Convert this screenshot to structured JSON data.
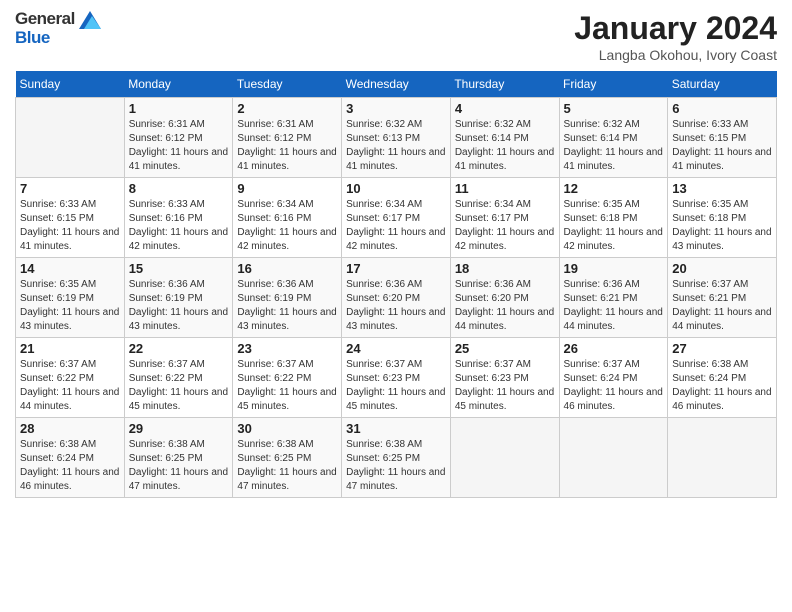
{
  "logo": {
    "general": "General",
    "blue": "Blue"
  },
  "title": "January 2024",
  "subtitle": "Langba Okohou, Ivory Coast",
  "days_header": [
    "Sunday",
    "Monday",
    "Tuesday",
    "Wednesday",
    "Thursday",
    "Friday",
    "Saturday"
  ],
  "weeks": [
    [
      {
        "num": "",
        "sunrise": "",
        "sunset": "",
        "daylight": ""
      },
      {
        "num": "1",
        "sunrise": "Sunrise: 6:31 AM",
        "sunset": "Sunset: 6:12 PM",
        "daylight": "Daylight: 11 hours and 41 minutes."
      },
      {
        "num": "2",
        "sunrise": "Sunrise: 6:31 AM",
        "sunset": "Sunset: 6:12 PM",
        "daylight": "Daylight: 11 hours and 41 minutes."
      },
      {
        "num": "3",
        "sunrise": "Sunrise: 6:32 AM",
        "sunset": "Sunset: 6:13 PM",
        "daylight": "Daylight: 11 hours and 41 minutes."
      },
      {
        "num": "4",
        "sunrise": "Sunrise: 6:32 AM",
        "sunset": "Sunset: 6:14 PM",
        "daylight": "Daylight: 11 hours and 41 minutes."
      },
      {
        "num": "5",
        "sunrise": "Sunrise: 6:32 AM",
        "sunset": "Sunset: 6:14 PM",
        "daylight": "Daylight: 11 hours and 41 minutes."
      },
      {
        "num": "6",
        "sunrise": "Sunrise: 6:33 AM",
        "sunset": "Sunset: 6:15 PM",
        "daylight": "Daylight: 11 hours and 41 minutes."
      }
    ],
    [
      {
        "num": "7",
        "sunrise": "Sunrise: 6:33 AM",
        "sunset": "Sunset: 6:15 PM",
        "daylight": "Daylight: 11 hours and 41 minutes."
      },
      {
        "num": "8",
        "sunrise": "Sunrise: 6:33 AM",
        "sunset": "Sunset: 6:16 PM",
        "daylight": "Daylight: 11 hours and 42 minutes."
      },
      {
        "num": "9",
        "sunrise": "Sunrise: 6:34 AM",
        "sunset": "Sunset: 6:16 PM",
        "daylight": "Daylight: 11 hours and 42 minutes."
      },
      {
        "num": "10",
        "sunrise": "Sunrise: 6:34 AM",
        "sunset": "Sunset: 6:17 PM",
        "daylight": "Daylight: 11 hours and 42 minutes."
      },
      {
        "num": "11",
        "sunrise": "Sunrise: 6:34 AM",
        "sunset": "Sunset: 6:17 PM",
        "daylight": "Daylight: 11 hours and 42 minutes."
      },
      {
        "num": "12",
        "sunrise": "Sunrise: 6:35 AM",
        "sunset": "Sunset: 6:18 PM",
        "daylight": "Daylight: 11 hours and 42 minutes."
      },
      {
        "num": "13",
        "sunrise": "Sunrise: 6:35 AM",
        "sunset": "Sunset: 6:18 PM",
        "daylight": "Daylight: 11 hours and 43 minutes."
      }
    ],
    [
      {
        "num": "14",
        "sunrise": "Sunrise: 6:35 AM",
        "sunset": "Sunset: 6:19 PM",
        "daylight": "Daylight: 11 hours and 43 minutes."
      },
      {
        "num": "15",
        "sunrise": "Sunrise: 6:36 AM",
        "sunset": "Sunset: 6:19 PM",
        "daylight": "Daylight: 11 hours and 43 minutes."
      },
      {
        "num": "16",
        "sunrise": "Sunrise: 6:36 AM",
        "sunset": "Sunset: 6:19 PM",
        "daylight": "Daylight: 11 hours and 43 minutes."
      },
      {
        "num": "17",
        "sunrise": "Sunrise: 6:36 AM",
        "sunset": "Sunset: 6:20 PM",
        "daylight": "Daylight: 11 hours and 43 minutes."
      },
      {
        "num": "18",
        "sunrise": "Sunrise: 6:36 AM",
        "sunset": "Sunset: 6:20 PM",
        "daylight": "Daylight: 11 hours and 44 minutes."
      },
      {
        "num": "19",
        "sunrise": "Sunrise: 6:36 AM",
        "sunset": "Sunset: 6:21 PM",
        "daylight": "Daylight: 11 hours and 44 minutes."
      },
      {
        "num": "20",
        "sunrise": "Sunrise: 6:37 AM",
        "sunset": "Sunset: 6:21 PM",
        "daylight": "Daylight: 11 hours and 44 minutes."
      }
    ],
    [
      {
        "num": "21",
        "sunrise": "Sunrise: 6:37 AM",
        "sunset": "Sunset: 6:22 PM",
        "daylight": "Daylight: 11 hours and 44 minutes."
      },
      {
        "num": "22",
        "sunrise": "Sunrise: 6:37 AM",
        "sunset": "Sunset: 6:22 PM",
        "daylight": "Daylight: 11 hours and 45 minutes."
      },
      {
        "num": "23",
        "sunrise": "Sunrise: 6:37 AM",
        "sunset": "Sunset: 6:22 PM",
        "daylight": "Daylight: 11 hours and 45 minutes."
      },
      {
        "num": "24",
        "sunrise": "Sunrise: 6:37 AM",
        "sunset": "Sunset: 6:23 PM",
        "daylight": "Daylight: 11 hours and 45 minutes."
      },
      {
        "num": "25",
        "sunrise": "Sunrise: 6:37 AM",
        "sunset": "Sunset: 6:23 PM",
        "daylight": "Daylight: 11 hours and 45 minutes."
      },
      {
        "num": "26",
        "sunrise": "Sunrise: 6:37 AM",
        "sunset": "Sunset: 6:24 PM",
        "daylight": "Daylight: 11 hours and 46 minutes."
      },
      {
        "num": "27",
        "sunrise": "Sunrise: 6:38 AM",
        "sunset": "Sunset: 6:24 PM",
        "daylight": "Daylight: 11 hours and 46 minutes."
      }
    ],
    [
      {
        "num": "28",
        "sunrise": "Sunrise: 6:38 AM",
        "sunset": "Sunset: 6:24 PM",
        "daylight": "Daylight: 11 hours and 46 minutes."
      },
      {
        "num": "29",
        "sunrise": "Sunrise: 6:38 AM",
        "sunset": "Sunset: 6:25 PM",
        "daylight": "Daylight: 11 hours and 47 minutes."
      },
      {
        "num": "30",
        "sunrise": "Sunrise: 6:38 AM",
        "sunset": "Sunset: 6:25 PM",
        "daylight": "Daylight: 11 hours and 47 minutes."
      },
      {
        "num": "31",
        "sunrise": "Sunrise: 6:38 AM",
        "sunset": "Sunset: 6:25 PM",
        "daylight": "Daylight: 11 hours and 47 minutes."
      },
      {
        "num": "",
        "sunrise": "",
        "sunset": "",
        "daylight": ""
      },
      {
        "num": "",
        "sunrise": "",
        "sunset": "",
        "daylight": ""
      },
      {
        "num": "",
        "sunrise": "",
        "sunset": "",
        "daylight": ""
      }
    ]
  ]
}
